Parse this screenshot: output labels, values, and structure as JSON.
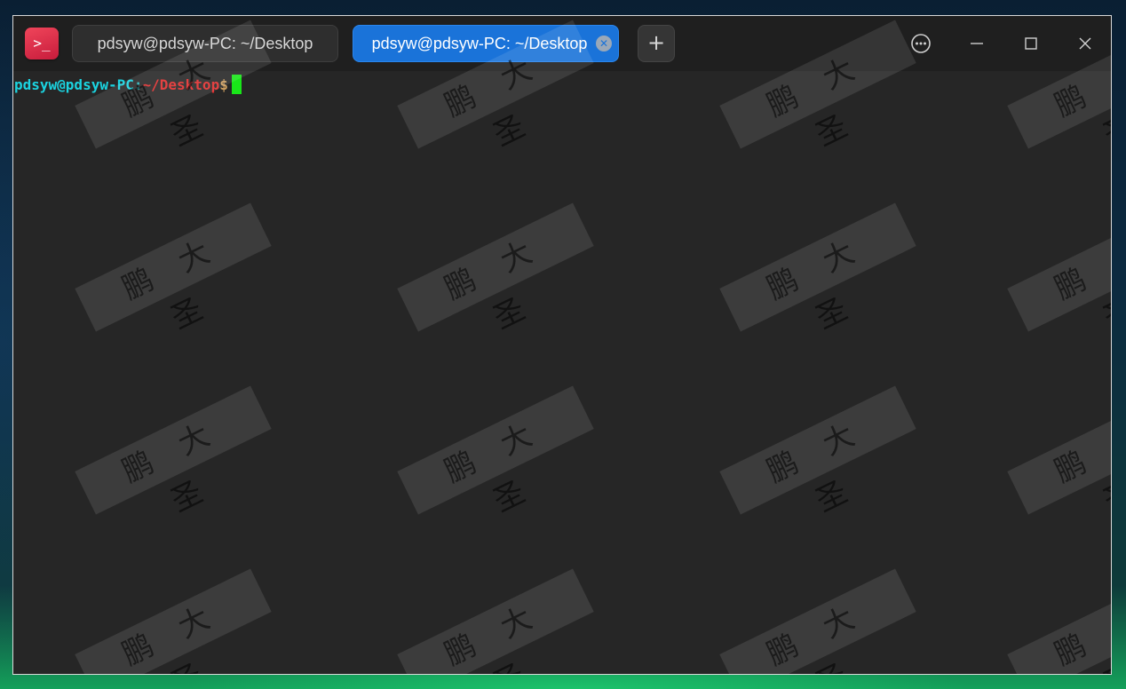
{
  "titlebar": {
    "app_icon_glyph": ">_",
    "app_icon_name": "terminal-icon",
    "tabs": [
      {
        "label": "pdsyw@pdsyw-PC: ~/Desktop",
        "active": false
      },
      {
        "label": "pdsyw@pdsyw-PC: ~/Desktop",
        "active": true
      }
    ],
    "tab_close_glyph": "✕",
    "add_tab_glyph": "+",
    "window_buttons": {
      "menu_icon": "more-options-icon",
      "minimize_icon": "minimize-icon",
      "maximize_icon": "maximize-icon",
      "close_icon": "close-icon"
    }
  },
  "terminal": {
    "prompt": {
      "user_host": "pdsyw@pdsyw-PC",
      "separator": ":",
      "path": "~/Desktop",
      "symbol": "$"
    },
    "background_color": "#262626",
    "cursor_color": "#19e619"
  },
  "watermark": {
    "text": "鹏大圣"
  },
  "colors": {
    "active_tab": "#1a73d9",
    "app_icon": "#e0304b",
    "prompt_user_host": "#1bd3e0",
    "prompt_path": "#e12d2d"
  }
}
